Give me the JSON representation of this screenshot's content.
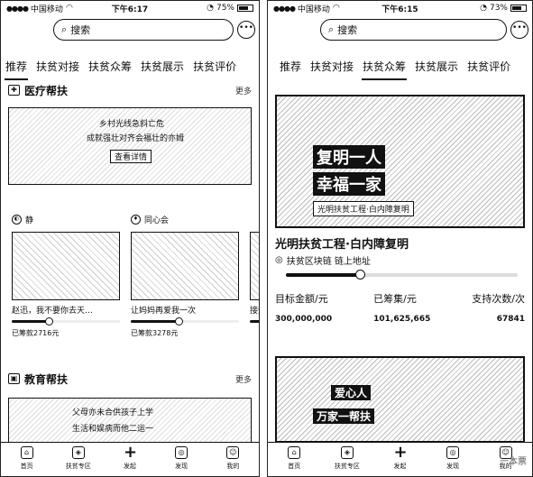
{
  "left": {
    "status": {
      "carrier": "中国移动",
      "time": "下午6:17",
      "battery": "75%",
      "battery_level": 0.75
    },
    "search": {
      "placeholder": "搜索"
    },
    "tabs": [
      "推荐",
      "扶贫对接",
      "扶贫众筹",
      "扶贫展示",
      "扶贫评价"
    ],
    "active_tab": 0,
    "medical": {
      "title": "医疗帮扶",
      "more": "更多",
      "banner_line1": "乡村光线急斜亡危",
      "banner_line2": "成就强壮对齐会福壮的亦姆",
      "banner_btn": "查看详情",
      "cards": [
        {
          "user": "静",
          "title": "赵迅，我不要你去天…",
          "progress": 0.35,
          "sub": "已筹款2716元"
        },
        {
          "user": "同心会",
          "title": "让妈妈再爱我一次",
          "progress": 0.45,
          "sub": "已筹款3278元"
        },
        {
          "user": "",
          "title": "接受",
          "progress": 0.3,
          "sub": ""
        }
      ]
    },
    "education": {
      "title": "教育帮扶",
      "more": "更多",
      "banner_line1": "父母亦未合供孩子上学",
      "banner_line2": "生活和娱病而他二运一"
    }
  },
  "right": {
    "status": {
      "carrier": "中国移动",
      "time": "下午6:15",
      "battery": "73%",
      "battery_level": 0.73
    },
    "search": {
      "placeholder": "搜索"
    },
    "tabs": [
      "推荐",
      "扶贫对接",
      "扶贫众筹",
      "扶贫展示",
      "扶贫评价"
    ],
    "active_tab": 2,
    "project": {
      "banner_line1": "复明一人",
      "banner_line2": "幸福一家",
      "banner_caption": "光明扶贫工程·白内障复明",
      "title": "光明扶贫工程·白内障复明",
      "org": "扶贫区块链 链上地址",
      "progress": 0.32,
      "stats": [
        {
          "label": "目标金额/元",
          "value": "300,000,000"
        },
        {
          "label": "已筹集/元",
          "value": "101,625,665"
        },
        {
          "label": "支持次数/次",
          "value": "67841"
        }
      ],
      "banner2_line1": "爱心人",
      "banner2_line2": "万家一帮扶"
    },
    "watermark": "一本票"
  },
  "nav": [
    {
      "label": "首页",
      "icon": "home-icon",
      "glyph": "⌂"
    },
    {
      "label": "扶贫专区",
      "icon": "bag-icon",
      "glyph": "◈"
    },
    {
      "label": "发起",
      "icon": "plus-icon",
      "glyph": "+"
    },
    {
      "label": "发现",
      "icon": "discover-icon",
      "glyph": "◎"
    },
    {
      "label": "我的",
      "icon": "profile-icon",
      "glyph": "☺"
    }
  ]
}
